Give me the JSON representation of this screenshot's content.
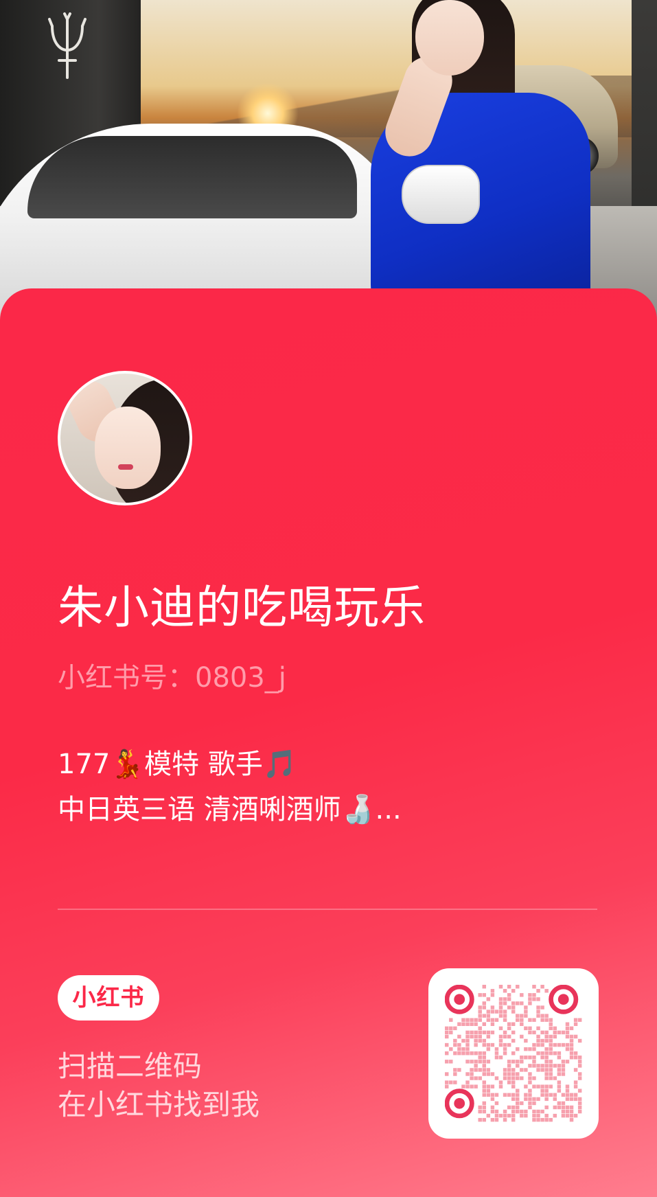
{
  "profile": {
    "name": "朱小迪的吃喝玩乐",
    "xhs_id": "小红书号：0803_j",
    "bio_line1": "177💃模特 歌手🎵",
    "bio_line2": "中日英三语 清酒唎酒师🍶..."
  },
  "footer": {
    "brand_label": "小红书",
    "scan_line1": "扫描二维码",
    "scan_line2": "在小红书找到我"
  },
  "colors": {
    "card_red": "#fb2848",
    "qr_dot": "#f6a0ad",
    "white": "#ffffff"
  },
  "icons": {
    "qr_code": "qr-code-icon",
    "trident_logo": "trident-logo-icon"
  }
}
